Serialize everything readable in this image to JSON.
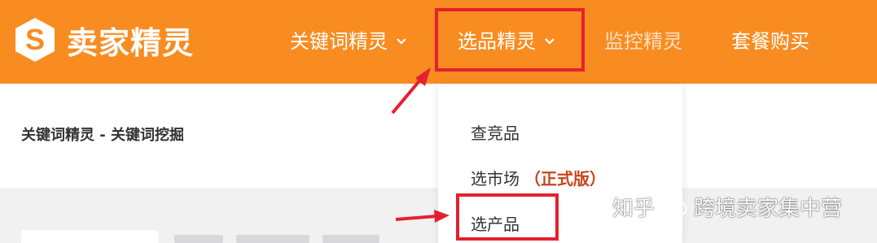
{
  "brand": {
    "name": "卖家精灵",
    "logo_letter": "S",
    "color_primary": "#f98c21"
  },
  "nav": {
    "items": [
      {
        "label": "关键词精灵",
        "has_caret": true
      },
      {
        "label": "选品精灵",
        "has_caret": true
      },
      {
        "label": "监控精灵",
        "has_caret": false
      },
      {
        "label": "套餐购买",
        "has_caret": false
      }
    ]
  },
  "breadcrumb": {
    "text": "关键词精灵 - 关键词挖掘"
  },
  "dropdown": {
    "items": [
      {
        "label": "查竞品",
        "tag": ""
      },
      {
        "label": "选市场",
        "tag": "（正式版）"
      },
      {
        "label": "选产品",
        "tag": ""
      }
    ]
  },
  "annotations": {
    "highlight_color": "#e4212e"
  },
  "watermark": {
    "left": "知乎",
    "icon": "wechat-icon",
    "right": "跨境卖家集中营"
  }
}
